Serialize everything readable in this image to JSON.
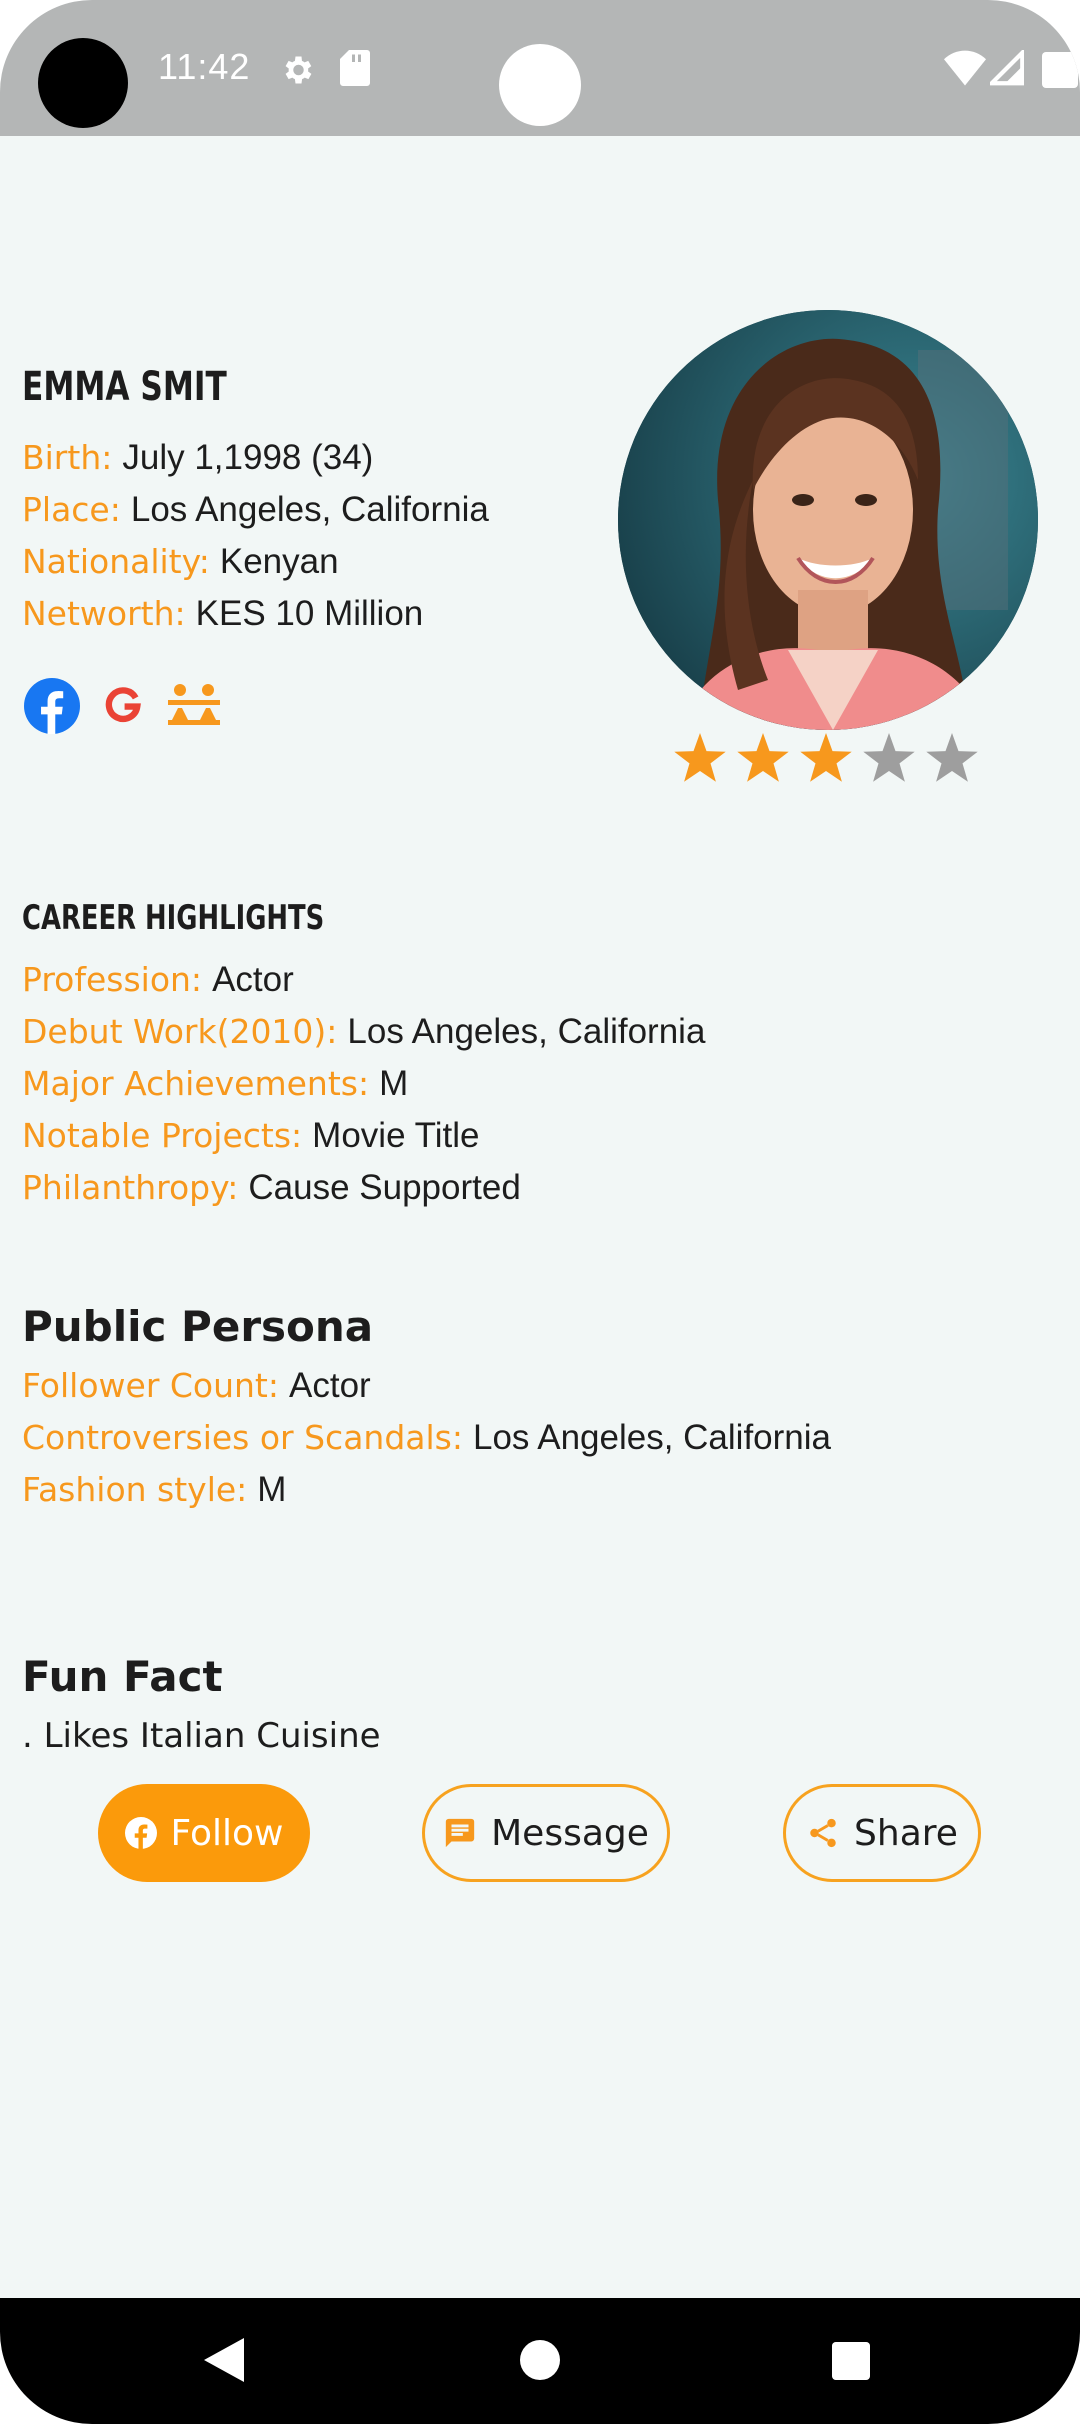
{
  "status_bar": {
    "time": "11:42"
  },
  "profile": {
    "name": "EMMA SMIT",
    "details": [
      {
        "label": "Birth:",
        "value": "July 1,1998 (34)"
      },
      {
        "label": "Place:",
        "value": "Los Angeles, California"
      },
      {
        "label": "Nationality:",
        "value": "Kenyan"
      },
      {
        "label": "Networth:",
        "value": "KES 10 Million"
      }
    ],
    "rating": 3,
    "rating_max": 5
  },
  "career": {
    "title": "CAREER HIGHLIGHTS",
    "items": [
      {
        "label": "Profession:",
        "value": "Actor"
      },
      {
        "label": "Debut Work(2010):",
        "value": "Los Angeles, California"
      },
      {
        "label": "Major Achievements:",
        "value": "M"
      },
      {
        "label": "Notable Projects:",
        "value": "Movie Title"
      },
      {
        "label": "Philanthropy:",
        "value": "Cause Supported"
      }
    ]
  },
  "persona": {
    "title": "Public Persona",
    "items": [
      {
        "label": "Follower Count:",
        "value": "Actor"
      },
      {
        "label": "Controversies or Scandals:",
        "value": "Los Angeles, California"
      },
      {
        "label": "Fashion style:",
        "value": "M"
      }
    ]
  },
  "fun_fact": {
    "title": "Fun Fact",
    "text": ". Likes Italian Cuisine"
  },
  "actions": {
    "follow": "Follow",
    "message": "Message",
    "share": "Share"
  },
  "colors": {
    "accent": "#f7981d",
    "star_on": "#f7981d",
    "star_off": "#9e9e9e"
  }
}
